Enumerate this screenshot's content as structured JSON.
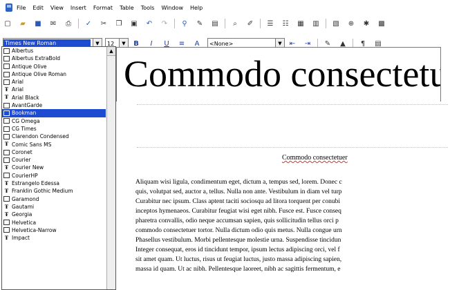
{
  "menubar": {
    "items": [
      "File",
      "Edit",
      "View",
      "Insert",
      "Format",
      "Table",
      "Tools",
      "Window",
      "Help"
    ]
  },
  "format_toolbar": {
    "font_name": "Times New Roman",
    "font_size": "12",
    "style": "<None>"
  },
  "font_list": {
    "items": [
      {
        "name": "Albertus",
        "type": "printer"
      },
      {
        "name": "Albertus ExtraBold",
        "type": "printer"
      },
      {
        "name": "Antique Olive",
        "type": "printer"
      },
      {
        "name": "Antique Olive Roman",
        "type": "printer"
      },
      {
        "name": "Arial",
        "type": "printer"
      },
      {
        "name": "Arial",
        "type": "truetype"
      },
      {
        "name": "Arial Black",
        "type": "truetype"
      },
      {
        "name": "AvantGarde",
        "type": "printer"
      },
      {
        "name": "Bookman",
        "type": "printer"
      },
      {
        "name": "CG Omega",
        "type": "printer"
      },
      {
        "name": "CG Times",
        "type": "printer"
      },
      {
        "name": "Clarendon Condensed",
        "type": "printer"
      },
      {
        "name": "Comic Sans MS",
        "type": "truetype"
      },
      {
        "name": "Coronet",
        "type": "printer"
      },
      {
        "name": "Courier",
        "type": "printer"
      },
      {
        "name": "Courier New",
        "type": "truetype"
      },
      {
        "name": "CourierHP",
        "type": "printer"
      },
      {
        "name": "Estrangelo Edessa",
        "type": "truetype"
      },
      {
        "name": "Franklin Gothic Medium",
        "type": "truetype"
      },
      {
        "name": "Garamond",
        "type": "printer"
      },
      {
        "name": "Gautami",
        "type": "truetype"
      },
      {
        "name": "Georgia",
        "type": "truetype"
      },
      {
        "name": "Helvetica",
        "type": "printer"
      },
      {
        "name": "Helvetica-Narrow",
        "type": "printer"
      },
      {
        "name": "Impact",
        "type": "truetype"
      }
    ],
    "selected_index": 8
  },
  "preview": {
    "text": "Commodo consectetuer"
  },
  "document": {
    "title": "Commodo consectetuer",
    "body_lines": [
      "Aliquam wisi ligula, condimentum eget, dictum a, tempus sed, lorem. Donec c",
      "quis, volutpat sed, auctor a, tellus. Nulla non ante. Vestibulum in diam vel turp",
      "Curabitur nec ipsum. Class aptent taciti sociosqu ad litora torquent per conubi",
      "inceptos hymenaeos. Curabitur feugiat wisi eget nibh. Fusce est. Fusce conseq",
      "pharetra convallis, odio neque accumsan sapien, quis sollicitudin tellus orci p",
      "commodo consectetuer tortor. Nulla dictum odio quis metus. Nulla congue urn",
      "Phasellus vestibulum. Morbi pellentesque molestie urna. Suspendisse tincidun",
      "Integer consequat, eros id tincidunt tempor, ipsum lectus adipiscing orci, vel f",
      "sit amet quam. Ut luctus, risus ut feugiat luctus, justo massa adipiscing sapien,",
      "massa id quam. Ut ac nibh. Pellentesque laoreet, nibh ac sagittis fermentum, e"
    ]
  }
}
